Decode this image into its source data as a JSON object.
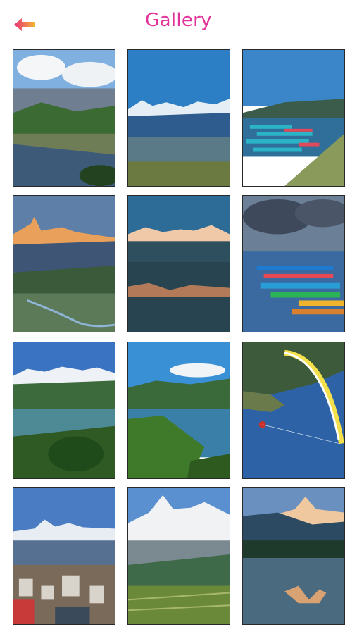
{
  "header": {
    "title": "Gallery",
    "back_icon": "arrow-left-icon",
    "accent_color": "#e2339a",
    "back_gradient": [
      "#f5b731",
      "#e8327a"
    ]
  },
  "gallery": {
    "photos": [
      {
        "subject": "lake-hills-clouds"
      },
      {
        "subject": "mountain-range-valley"
      },
      {
        "subject": "boats-shore"
      },
      {
        "subject": "peak-sunrise-valley"
      },
      {
        "subject": "mountain-reflection-lake"
      },
      {
        "subject": "boats-lake-cloudy"
      },
      {
        "subject": "snow-peaks-lake-town"
      },
      {
        "subject": "lake-green-hills"
      },
      {
        "subject": "paraglider-lake"
      },
      {
        "subject": "snow-peak-city"
      },
      {
        "subject": "snow-peak-terraces"
      },
      {
        "subject": "peak-reflection-dawn"
      }
    ]
  }
}
